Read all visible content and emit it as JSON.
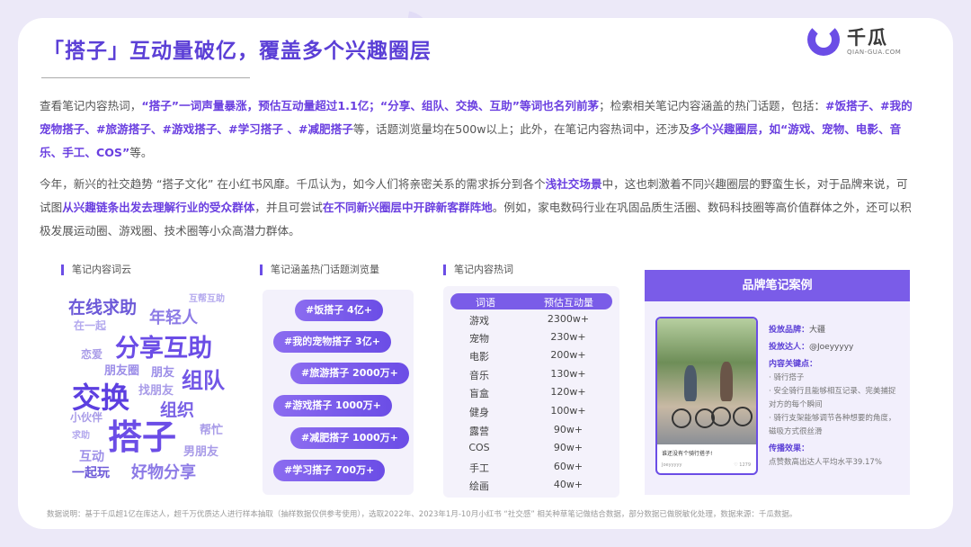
{
  "title": "「搭子」互动量破亿，覆盖多个兴趣圈层",
  "brand": {
    "name": "千瓜",
    "sub": "QIAN-GUA.COM",
    "watermark": "千瓜"
  },
  "para1": {
    "t1": "查看笔记内容热词，",
    "h1": "“搭子”一词声量暴涨，预估互动量超过1.1亿；“分享、组队、交换、互助”等词也名列前茅",
    "t2": "；检索相关笔记内容涵盖的热门话题，包括：",
    "h2": "#饭搭子、#我的宠物搭子、#旅游搭子、#游戏搭子、#学习搭子 、#减肥搭子",
    "t3": "等，话题浏览量均在500w以上；此外，在笔记内容热词中，还涉及",
    "h3": "多个兴趣圈层，如“游戏、宠物、电影、音乐、手工、COS”",
    "t4": "等。"
  },
  "para2": {
    "t1": "今年，新兴的社交趋势 “搭子文化” 在小红书风靡。千瓜认为，如今人们将亲密关系的需求拆分到各个",
    "h1": "浅社交场景",
    "t2": "中，这也刺激着不同兴趣圈层的野蛮生长，对于品牌来说，可试图",
    "h2": "从兴趣链条出发去理解行业的受众群体",
    "t3": "，并且可尝试",
    "h3": "在不同新兴圈层中开辟新客群阵地",
    "t4": "。例如，家电数码行业在巩固品质生活圈、数码科技圈等高价值群体之外，还可以积极发展运动圈、游戏圈、技术圈等小众高潜力群体。"
  },
  "sections": {
    "wordcloud": "笔记内容词云",
    "topics": "笔记涵盖热门话题浏览量",
    "hotwords": "笔记内容热词",
    "case": "品牌笔记案例"
  },
  "wordcloud": [
    "在线求助",
    "年轻人",
    "在一起",
    "互帮互助",
    "分享互助",
    "恋爱",
    "朋友圈",
    "朋友",
    "组队",
    "交换",
    "找朋友",
    "组织",
    "小伙伴",
    "求助",
    "帮忙",
    "搭子",
    "互动",
    "男朋友",
    "一起玩",
    "好物分享"
  ],
  "topic_tags": [
    "#饭搭子 4亿+",
    "#我的宠物搭子 3亿+",
    "#旅游搭子 2000万+",
    "#游戏搭子 1000万+",
    "#减肥搭子 1000万+",
    "#学习搭子 700万+"
  ],
  "hotword_table": {
    "headers": [
      "词语",
      "预估互动量"
    ],
    "rows": [
      [
        "游戏",
        "2300w+"
      ],
      [
        "宠物",
        "230w+"
      ],
      [
        "电影",
        "200w+"
      ],
      [
        "音乐",
        "130w+"
      ],
      [
        "盲盒",
        "120w+"
      ],
      [
        "健身",
        "100w+"
      ],
      [
        "露营",
        "90w+"
      ],
      [
        "COS",
        "90w+"
      ],
      [
        "手工",
        "60w+"
      ],
      [
        "绘画",
        "40w+"
      ]
    ]
  },
  "case": {
    "phone_caption": "谁还没有个骑行搭子!",
    "phone_user": "Joeyyyyy",
    "phone_likes": "♡ 1279",
    "brand_label": "投放品牌：",
    "brand_value": "大疆",
    "kol_label": "投放达人：",
    "kol_value": "@Joeyyyyy",
    "keys_label": "内容关键点：",
    "key1": "· 骑行搭子",
    "key2": "· 安全骑行且能够相互记录、完美捕捉对方的每个瞬间",
    "key3": "· 骑行支架能够调节各种想要的角度，磁吸方式很丝滑",
    "effect_label": "传播效果：",
    "effect_value": "点赞数高出达人平均水平39.17%"
  },
  "footer": "数据说明：基于千瓜超1亿在库达人，超千万优质达人进行样本抽取（抽样数据仅供参考使用），选取2022年、2023年1月-10月小红书 “社交感” 相关种草笔记做结合数据，部分数据已做脱敏化处理，数据来源：千瓜数据。",
  "colors": {
    "accent": "#6b4de6",
    "title": "#5b3fd6",
    "highlight": "#6a3fe0"
  }
}
